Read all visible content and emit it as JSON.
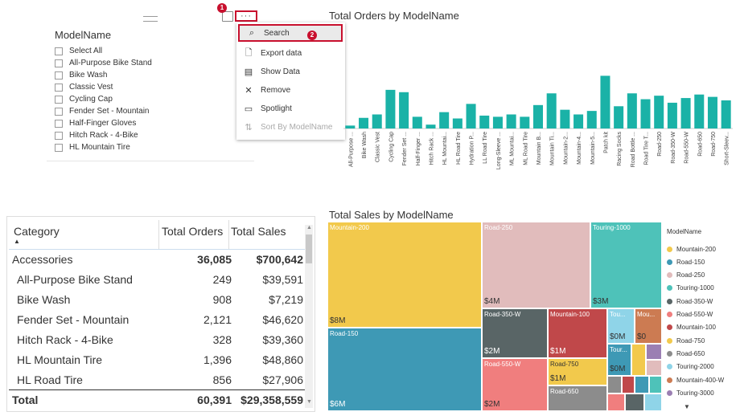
{
  "slicer": {
    "title": "ModelName",
    "more_label": "···",
    "items": [
      "Select All",
      "All-Purpose Bike Stand",
      "Bike Wash",
      "Classic Vest",
      "Cycling Cap",
      "Fender Set - Mountain",
      "Half-Finger Gloves",
      "Hitch Rack - 4-Bike",
      "HL Mountain Tire"
    ]
  },
  "step_badges": {
    "one": "1",
    "two": "2"
  },
  "context_menu": {
    "items": [
      {
        "label": "Search",
        "icon": "search-icon",
        "glyph": "⌕"
      },
      {
        "label": "Export data",
        "icon": "export-icon",
        "glyph": "🗋"
      },
      {
        "label": "Show Data",
        "icon": "show-data-icon",
        "glyph": "▤"
      },
      {
        "label": "Remove",
        "icon": "close-icon",
        "glyph": "✕"
      },
      {
        "label": "Spotlight",
        "icon": "spotlight-icon",
        "glyph": "▭"
      },
      {
        "label": "Sort By ModelName",
        "icon": "sort-icon",
        "glyph": "⇅"
      }
    ]
  },
  "orders_chart": {
    "title": "Total Orders by ModelName",
    "color": "#1ab2a7"
  },
  "chart_data": [
    {
      "type": "bar",
      "title": "Total Orders by ModelName",
      "categories": [
        "All-Purpose ...",
        "Bike Wash",
        "Classic Vest",
        "Cycling Cap",
        "Fender Set ...",
        "Half-Finger ...",
        "Hitch Rack ...",
        "HL Mountai...",
        "HL Road Tire",
        "Hydration P...",
        "LL Road Tire",
        "Long-Sleeve ...",
        "ML Mountai...",
        "ML Road Tire",
        "Mountain B...",
        "Mountain Ti...",
        "Mountain-2...",
        "Mountain-4...",
        "Mountain-5...",
        "Patch kit",
        "Racing Socks",
        "Road Bottle ...",
        "Road Tire T...",
        "Road-250",
        "Road-350-W",
        "Road-550-W",
        "Road-650",
        "Road-750",
        "Short-Sleev..."
      ],
      "values": [
        249,
        908,
        1200,
        3300,
        3100,
        1000,
        328,
        1396,
        856,
        2100,
        1100,
        1000,
        1200,
        1000,
        2000,
        3000,
        1600,
        1200,
        1500,
        4500,
        1900,
        3000,
        2500,
        2800,
        2200,
        2600,
        2900,
        2700,
        2400
      ],
      "ylim": [
        0,
        4800
      ]
    }
  ],
  "table": {
    "headers": {
      "category": "Category",
      "orders": "Total Orders",
      "sales": "Total Sales"
    },
    "rows": [
      {
        "name": "Accessories",
        "orders": "36,085",
        "sales": "$700,642",
        "bold": true
      },
      {
        "name": "All-Purpose Bike Stand",
        "orders": "249",
        "sales": "$39,591"
      },
      {
        "name": "Bike Wash",
        "orders": "908",
        "sales": "$7,219"
      },
      {
        "name": "Fender Set - Mountain",
        "orders": "2,121",
        "sales": "$46,620"
      },
      {
        "name": "Hitch Rack - 4-Bike",
        "orders": "328",
        "sales": "$39,360"
      },
      {
        "name": "HL Mountain Tire",
        "orders": "1,396",
        "sales": "$48,860"
      },
      {
        "name": "HL Road Tire",
        "orders": "856",
        "sales": "$27,906"
      }
    ],
    "total": {
      "name": "Total",
      "orders": "60,391",
      "sales": "$29,358,559"
    }
  },
  "treemap": {
    "title": "Total Sales by ModelName",
    "legend_title": "ModelName",
    "tiles": [
      {
        "label": "Mountain-200",
        "value": "$8M",
        "color": "#f2c94c"
      },
      {
        "label": "Road-150",
        "value": "$6M",
        "color": "#3e99b5"
      },
      {
        "label": "Road-250",
        "value": "$4M",
        "color": "#e1bcbc"
      },
      {
        "label": "Touring-1000",
        "value": "$3M",
        "color": "#4ec2b9"
      },
      {
        "label": "Road-350-W",
        "value": "$2M",
        "color": "#596566"
      },
      {
        "label": "Mountain-100",
        "value": "$1M",
        "color": "#c0484a"
      },
      {
        "label": "Road-550-W",
        "value": "$2M",
        "color": "#f07e7e"
      },
      {
        "label": "Road-750",
        "value": "$1M",
        "color": "#f2c94c"
      },
      {
        "label": "Road-650",
        "value": "",
        "color": "#8c8c8c"
      },
      {
        "label": "Tou...",
        "value": "$0M",
        "color": "#8fd4e8"
      },
      {
        "label": "Mou...",
        "value": "$0",
        "color": "#cc7b52"
      },
      {
        "label": "Tour...",
        "value": "$0M",
        "color": "#3e99b5"
      }
    ],
    "legend": [
      {
        "label": "Mountain-200",
        "color": "#f2c94c"
      },
      {
        "label": "Road-150",
        "color": "#3e99b5"
      },
      {
        "label": "Road-250",
        "color": "#e1bcbc"
      },
      {
        "label": "Touring-1000",
        "color": "#4ec2b9"
      },
      {
        "label": "Road-350-W",
        "color": "#596566"
      },
      {
        "label": "Road-550-W",
        "color": "#f07e7e"
      },
      {
        "label": "Mountain-100",
        "color": "#c0484a"
      },
      {
        "label": "Road-750",
        "color": "#f2c94c"
      },
      {
        "label": "Road-650",
        "color": "#8c8c8c"
      },
      {
        "label": "Touring-2000",
        "color": "#8fd4e8"
      },
      {
        "label": "Mountain-400-W",
        "color": "#cc7b52"
      },
      {
        "label": "Touring-3000",
        "color": "#9b7fb3"
      }
    ]
  }
}
